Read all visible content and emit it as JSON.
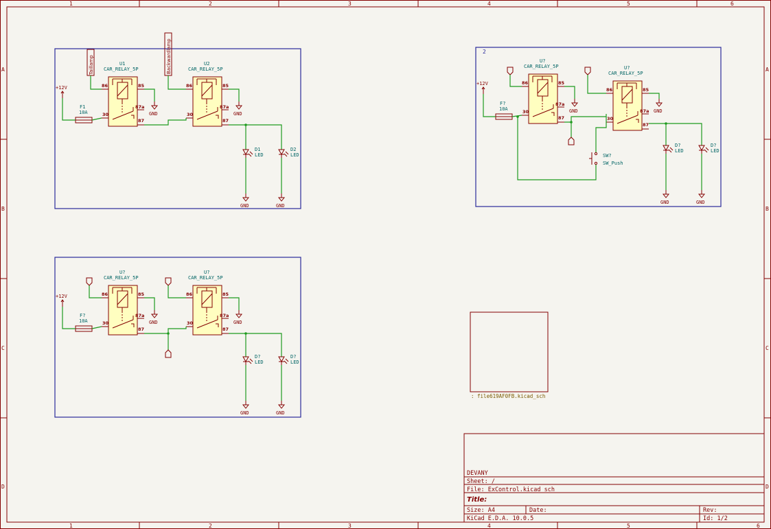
{
  "ruler": {
    "cols": [
      "1",
      "2",
      "3",
      "4",
      "5",
      "6"
    ],
    "rows": [
      "A",
      "B",
      "C",
      "D"
    ]
  },
  "group1": {
    "relay1": {
      "ref": "U1",
      "value": "CAR_RELAY_5P"
    },
    "relay2": {
      "ref": "U2",
      "value": "CAR_RELAY_5P"
    },
    "fuse": {
      "ref": "F1",
      "value": "10A"
    },
    "led1": {
      "ref": "D1",
      "value": "LED"
    },
    "led2": {
      "ref": "D2",
      "value": "LED"
    },
    "label1": "Taillamp",
    "label2": "Backwardlamp",
    "supply": "+12V",
    "gnd": "GND"
  },
  "group2": {
    "number": "2",
    "relay1": {
      "ref": "U?",
      "value": "CAR_RELAY_5P"
    },
    "relay2": {
      "ref": "U?",
      "value": "CAR_RELAY_5P"
    },
    "fuse": {
      "ref": "F?",
      "value": "10A"
    },
    "led1": {
      "ref": "D?",
      "value": "LED"
    },
    "led2": {
      "ref": "D?",
      "value": "LED"
    },
    "switch": {
      "ref": "SW?",
      "value": "SW_Push"
    },
    "supply": "+12V",
    "gnd": "GND"
  },
  "group3": {
    "relay1": {
      "ref": "U?",
      "value": "CAR_RELAY_5P"
    },
    "relay2": {
      "ref": "U?",
      "value": "CAR_RELAY_5P"
    },
    "fuse": {
      "ref": "F?",
      "value": "10A"
    },
    "led1": {
      "ref": "D?",
      "value": "LED"
    },
    "led2": {
      "ref": "D?",
      "value": "LED"
    },
    "supply": "+12V",
    "gnd": "GND"
  },
  "pins": {
    "p86": "86",
    "p85": "85",
    "p87a": "87a",
    "p30": "30",
    "p87": "87"
  },
  "subsheet": {
    "file": ": file619AF0FB.kicad_sch"
  },
  "titleblock": {
    "company": "DEVANY",
    "sheet": "Sheet: /",
    "file": "File: ExControl.kicad_sch",
    "title": "Title:",
    "size": "Size: A4",
    "date": "Date:",
    "rev": "Rev:",
    "tool": "KiCad E.D.A. 10.0.5",
    "id": "Id: 1/2"
  },
  "colors": {
    "wire": "#1f9a1f",
    "component": "#840000",
    "sheet_border": "#2a2a9a",
    "body_fill": "#fffec0"
  }
}
